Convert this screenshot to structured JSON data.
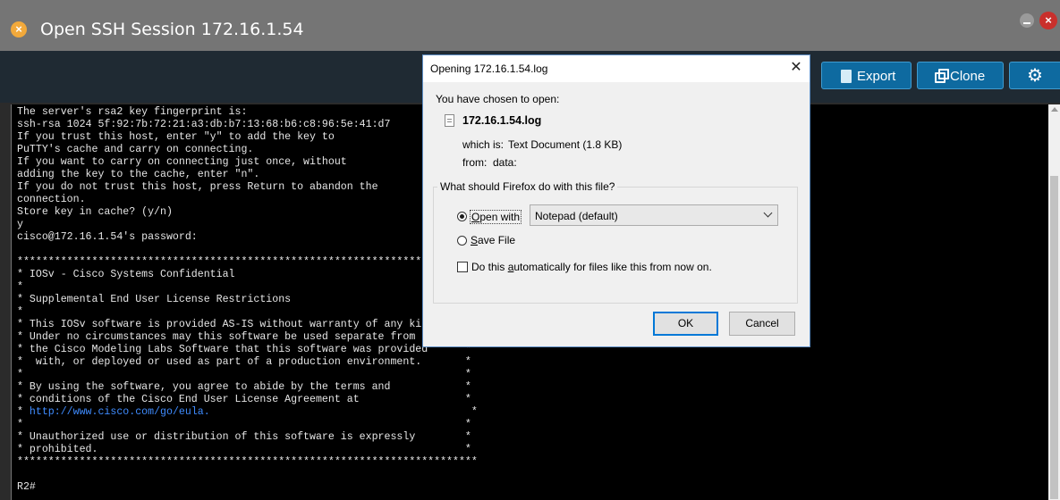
{
  "window": {
    "title": "Open SSH Session 172.16.1.54",
    "icon": "close-circle-icon"
  },
  "toolbar": {
    "export_label": "Export",
    "clone_label": "Clone",
    "export_icon": "ssh-file-icon",
    "clone_icon": "copy-icon",
    "settings_icon": "gear-icon"
  },
  "terminal": {
    "lines": [
      "The server's rsa2 key fingerprint is:",
      "ssh-rsa 1024 5f:92:7b:72:21:a3:db:b7:13:68:b6:c8:96:5e:41:d7",
      "If you trust this host, enter \"y\" to add the key to",
      "PuTTY's cache and carry on connecting.",
      "If you want to carry on connecting just once, without",
      "adding the key to the cache, enter \"n\".",
      "If you do not trust this host, press Return to abandon the",
      "connection.",
      "Store key in cache? (y/n)",
      "y",
      "cisco@172.16.1.54's password:",
      "",
      "**************************************************************************",
      "* IOSv - Cisco Systems Confidential",
      "*",
      "* Supplemental End User License Restrictions",
      "*",
      "* This IOSv software is provided AS-IS without warranty of any ki",
      "* Under no circumstances may this software be used separate from",
      "* the Cisco Modeling Labs Software that this software was provided      *",
      "*  with, or deployed or used as part of a production environment.       *",
      "*                                                                       *",
      "* By using the software, you agree to abide by the terms and            *",
      "* conditions of the Cisco End User License Agreement at                 *",
      "* ",
      "*                                                                       *",
      "* Unauthorized use or distribution of this software is expressly        *",
      "* prohibited.                                                           *",
      "**************************************************************************"
    ],
    "eula_url": "http://www.cisco.com/go/eula.",
    "eula_pad": "                                          *",
    "prompt": "R2#"
  },
  "dialog": {
    "title": "Opening 172.16.1.54.log",
    "close_icon": "close-icon",
    "chosen_label": "You have chosen to open:",
    "file_icon": "text-file-icon",
    "file_name": "172.16.1.54.log",
    "which_is_label": "which is:",
    "which_is_value": "Text Document (1.8 KB)",
    "from_label": "from:",
    "from_value": "data:",
    "question": "What should Firefox do with this file?",
    "open_with_pre": "",
    "open_with_acc": "O",
    "open_with_post": "pen with",
    "open_with_app": "Notepad (default)",
    "save_pre": "",
    "save_acc": "S",
    "save_post": "ave File",
    "auto_pre": "Do this ",
    "auto_acc": "a",
    "auto_post": "utomatically for files like this from now on.",
    "ok_label": "OK",
    "cancel_label": "Cancel",
    "selected_option": "open_with",
    "auto_checked": false
  }
}
